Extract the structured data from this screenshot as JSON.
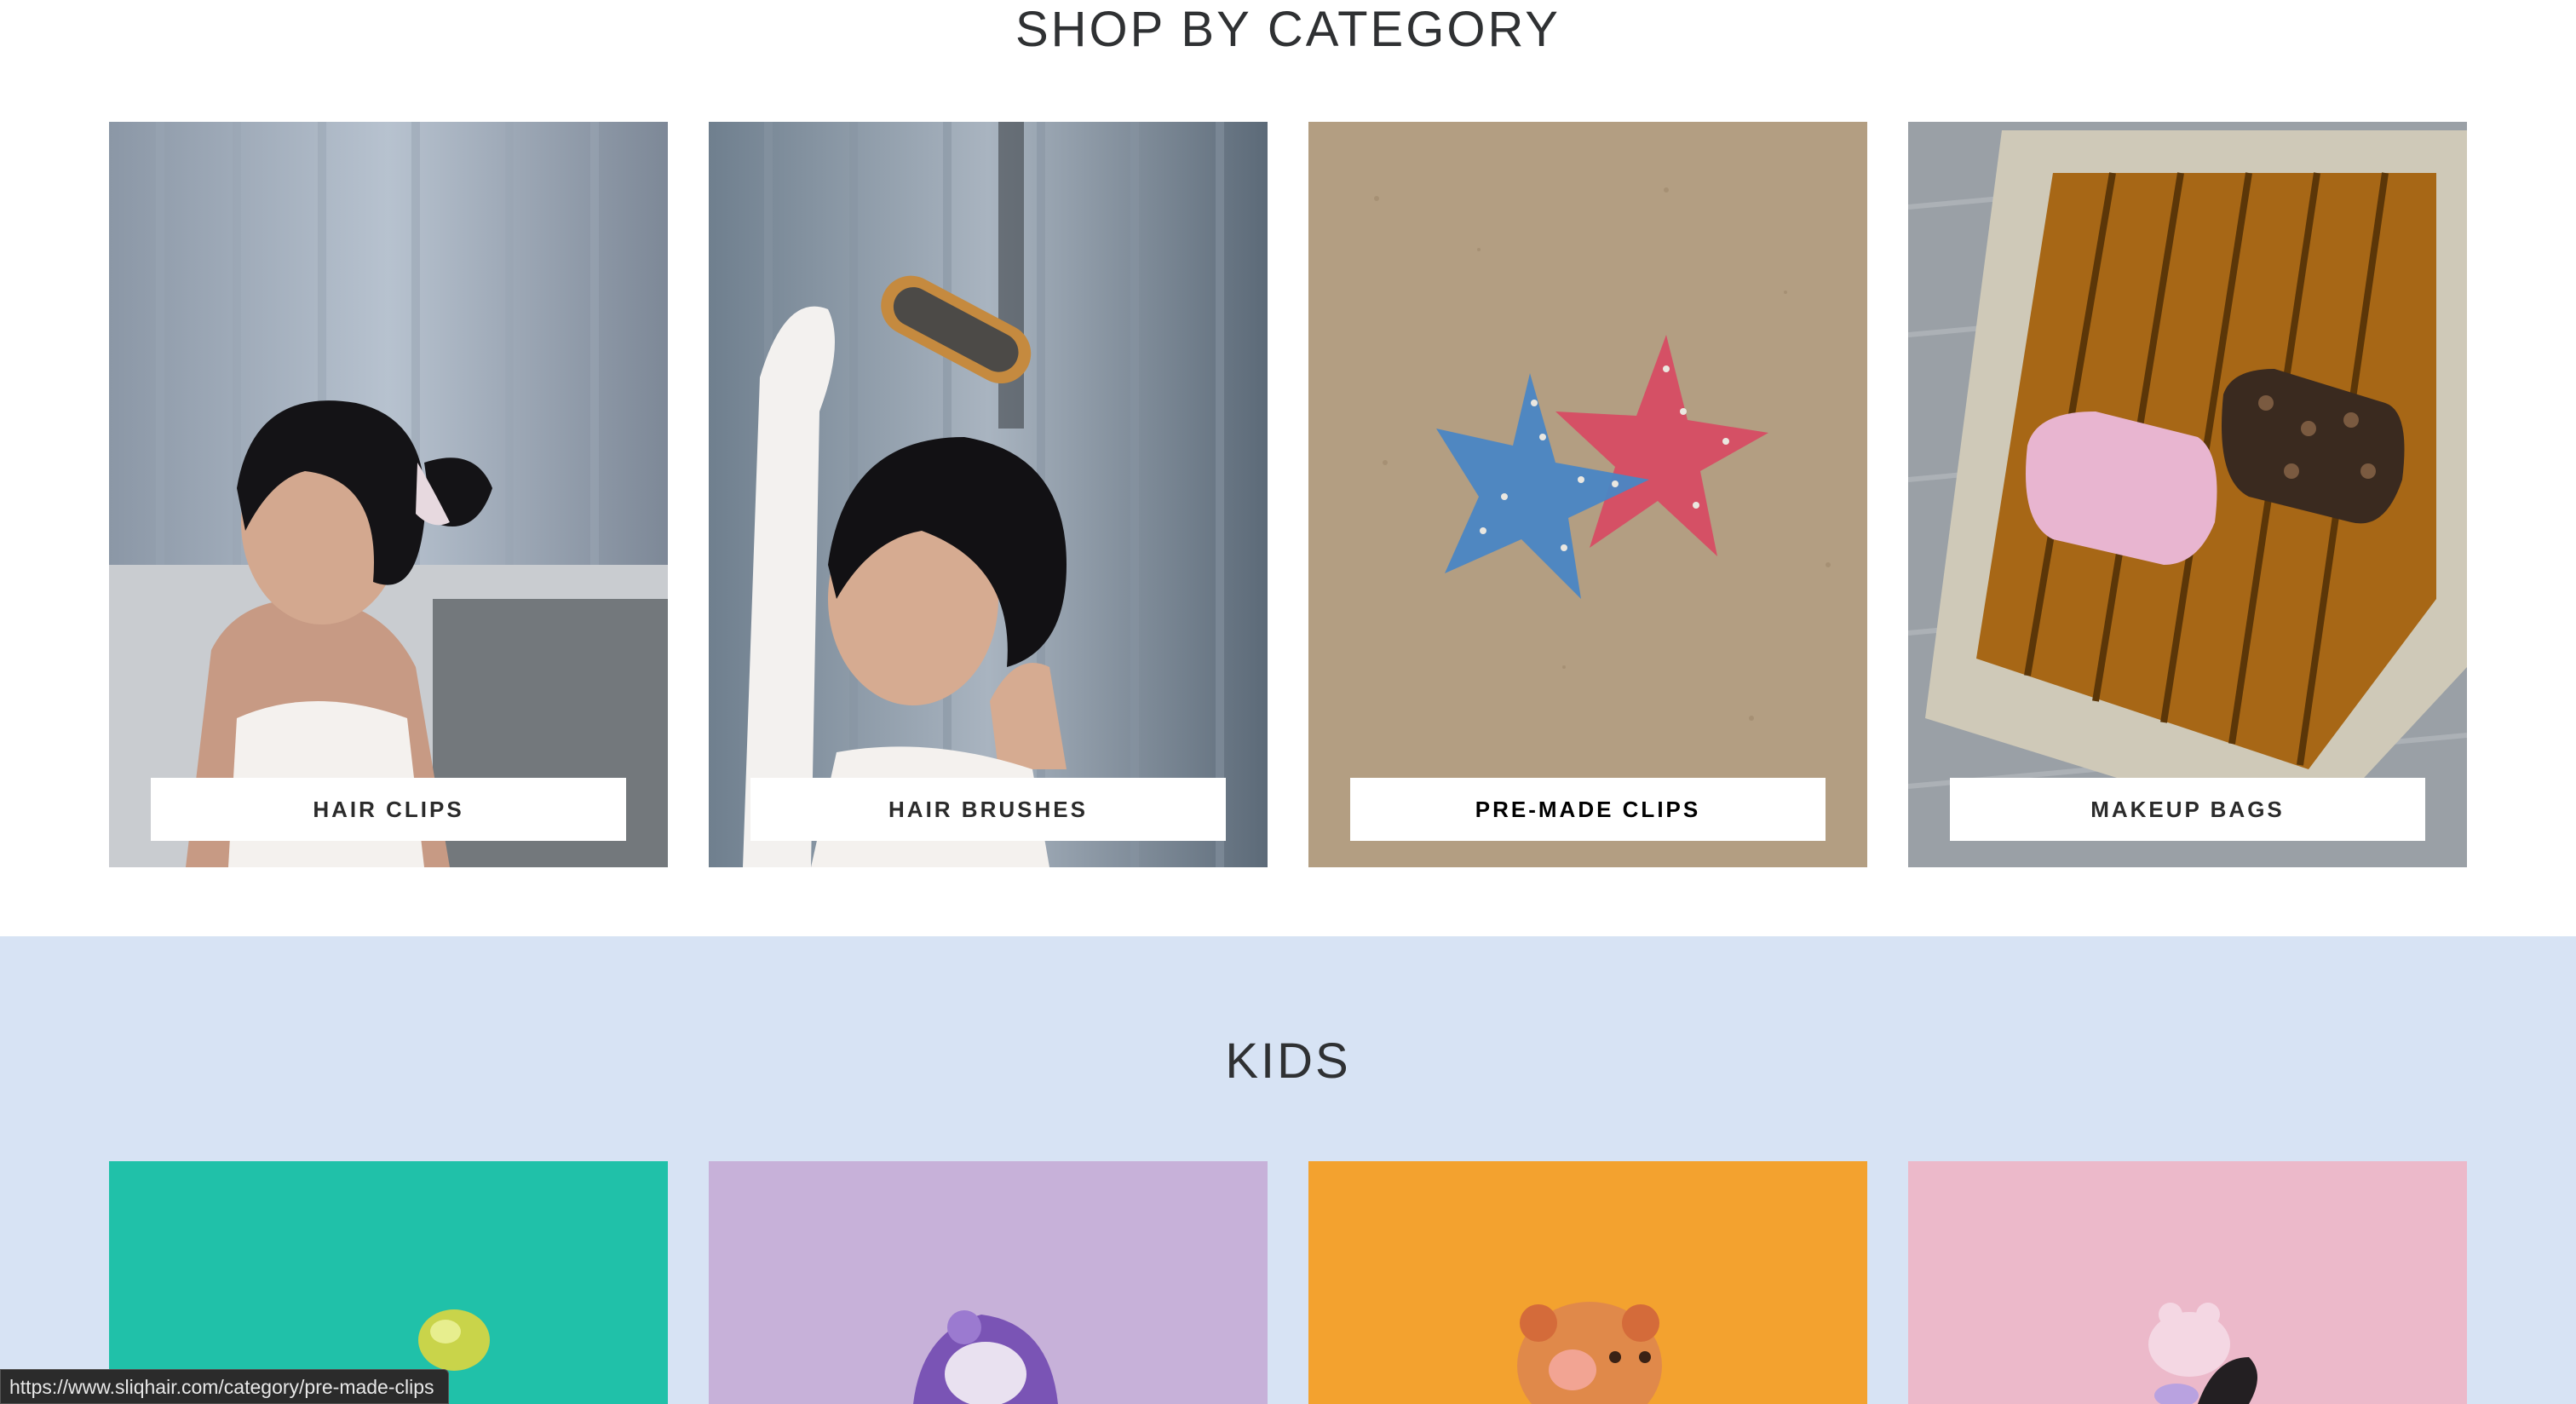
{
  "shop_by_category": {
    "title": "SHOP BY CATEGORY",
    "categories": [
      {
        "label": "HAIR CLIPS",
        "photo": "woman-with-claw-clip-photo"
      },
      {
        "label": "HAIR BRUSHES",
        "photo": "woman-brushing-hair-photo"
      },
      {
        "label": "PRE-MADE CLIPS",
        "photo": "starfish-clips-on-sand-photo"
      },
      {
        "label": "MAKEUP BAGS",
        "photo": "makeup-bags-on-tray-photo"
      }
    ]
  },
  "kids": {
    "title": "KIDS",
    "products": [
      {
        "photo": "kids-clip-teal-photo",
        "background": "#20c1a9"
      },
      {
        "photo": "kids-clip-lavender-photo",
        "background": "#c7b1d9"
      },
      {
        "photo": "kids-clip-orange-photo",
        "background": "#f3a22f"
      },
      {
        "photo": "kids-clip-pink-photo",
        "background": "#ecb9ca"
      }
    ]
  },
  "status_bar": {
    "url": "https://www.sliqhair.com/category/pre-made-clips"
  },
  "colors": {
    "kids_section_bg": "#d7e3f4",
    "title_text": "#2f3133"
  }
}
